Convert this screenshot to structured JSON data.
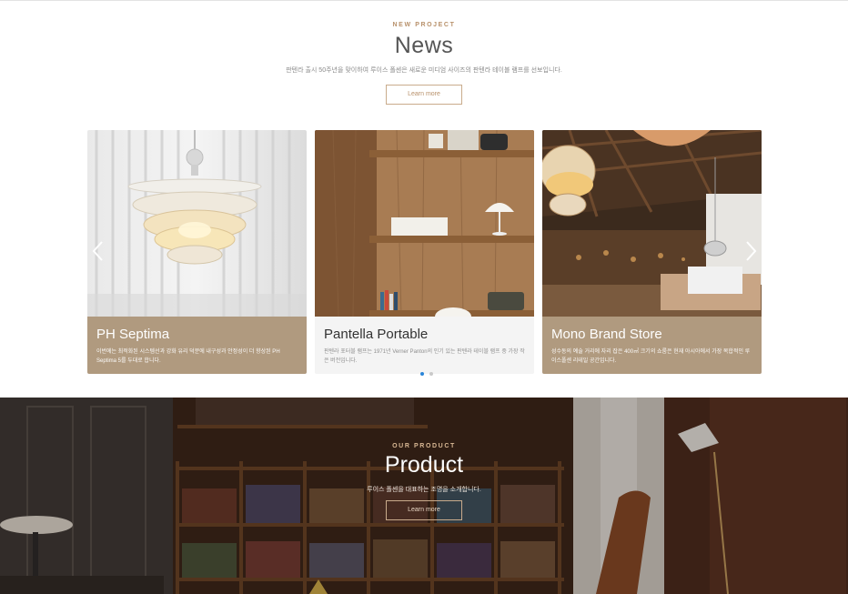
{
  "news": {
    "eyebrow": "NEW PROJECT",
    "title": "News",
    "description": "판텐라 출시 50주년을 맞이하여 루이스 폴센은 새로운 미디엄 사이즈의 판텐라 테이블 램프를 선보입니다.",
    "button": "Learn more"
  },
  "slides": [
    {
      "title": "PH Septima",
      "description": "이번에는 최적화된 시스템선과 강화 유리 덕분에 내구성과 안정성이 더 향상된 PH Septima 5를 두대로 합니다.",
      "image": "pendant-lamp-photo"
    },
    {
      "title": "Pantella Portable",
      "description": "판텐라 포터블 램프는 1971년 Verner Panton의 인기 있는 판텐라 테이블 램프 중 가장 작은 버전입니다.",
      "image": "bookshelf-lamp-photo"
    },
    {
      "title": "Mono Brand Store",
      "description": "성수동의 예술 거리에 자리 잡은 400㎡ 크기의 쇼룸은 현재 아시아에서 가장 복합적인 루이스폴센 리테일 공간입니다.",
      "image": "brand-store-photo"
    }
  ],
  "slider": {
    "prev_icon": "chevron-left-icon",
    "next_icon": "chevron-right-icon",
    "dots": 2,
    "active_dot": 0
  },
  "product": {
    "eyebrow": "OUR PRODUCT",
    "title": "Product",
    "description": "루이스 폴센을 대표하는 조명을 소개합니다.",
    "button": "Learn more"
  },
  "colors": {
    "accent": "#b8916b",
    "caption_tan": "#b09a7f",
    "dot_active": "#2b86d9"
  }
}
